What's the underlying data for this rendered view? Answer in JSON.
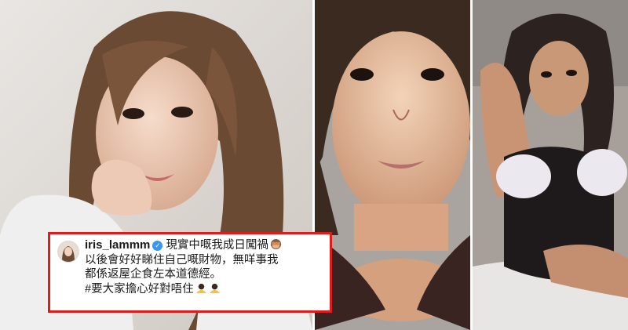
{
  "caption": {
    "username": "iris_lammm",
    "line1": "現實中嘅我成日闖禍",
    "line2": "以後會好好睇住自己嘅財物，無咩事我",
    "line3": "都係返屋企食左本道德經。",
    "line4": "#要大家擔心好對唔住",
    "emoji_line1": "see-no-evil-monkey",
    "emoji_line4": "person-bowing",
    "border_color": "#e01b1b",
    "verified_color": "#3897f0"
  },
  "photos": [
    {
      "id": "left",
      "subject": "woman with long brown hair resting chin on hand, white lace top"
    },
    {
      "id": "middle",
      "subject": "close-up selfie, dark top"
    },
    {
      "id": "right",
      "subject": "woman in black and white maid-style outfit on bed"
    }
  ]
}
